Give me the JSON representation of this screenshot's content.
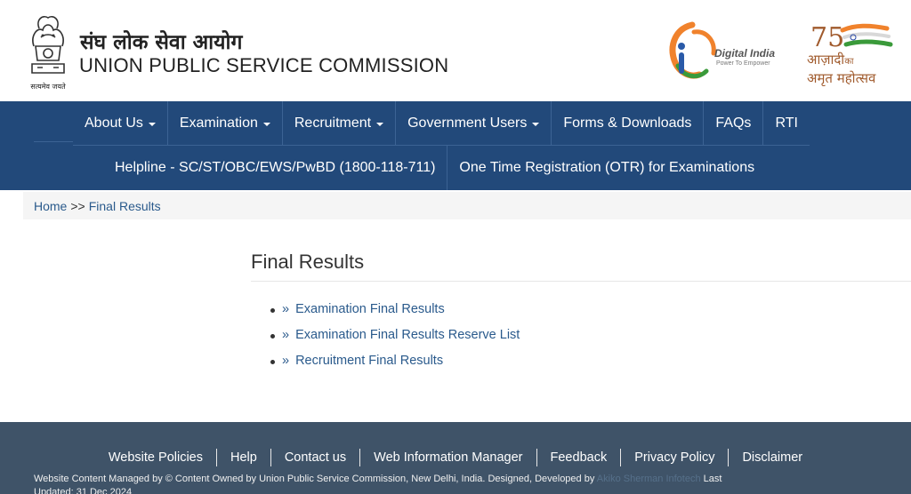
{
  "header": {
    "emblem_motto": "सत्यमेव जयते",
    "title_hindi": "संघ लोक सेवा आयोग",
    "title_english": "UNION PUBLIC SERVICE COMMISSION",
    "digital_india": {
      "name": "Digital India",
      "tagline": "Power To Empower"
    },
    "azadi": {
      "number": "75",
      "line1": "आज़ादी",
      "line1_small": "का",
      "line2": "अमृत महोत्सव"
    }
  },
  "nav": {
    "row1": [
      {
        "label": "About Us",
        "dropdown": true
      },
      {
        "label": "Examination",
        "dropdown": true
      },
      {
        "label": "Recruitment",
        "dropdown": true
      },
      {
        "label": "Government Users",
        "dropdown": true
      },
      {
        "label": "Forms & Downloads",
        "dropdown": false
      },
      {
        "label": "FAQs",
        "dropdown": false
      },
      {
        "label": "RTI",
        "dropdown": false
      }
    ],
    "row2": [
      {
        "label": "Helpline - SC/ST/OBC/EWS/PwBD (1800-118-711)"
      },
      {
        "label": "One Time Registration (OTR) for Examinations"
      }
    ]
  },
  "breadcrumb": {
    "home": "Home",
    "separator": ">>",
    "current": "Final Results"
  },
  "content": {
    "title": "Final Results",
    "links": [
      {
        "marker": "»",
        "label": "Examination Final Results"
      },
      {
        "marker": "»",
        "label": "Examination Final Results Reserve List"
      },
      {
        "marker": "»",
        "label": "Recruitment Final Results"
      }
    ]
  },
  "footer": {
    "links": [
      "Website Policies",
      "Help",
      "Contact us",
      "Web Information Manager",
      "Feedback",
      "Privacy Policy",
      "Disclaimer"
    ],
    "text_prefix": "Website Content Managed by © Content Owned by Union Public Service Commission, New Delhi, India. Designed, Developed by",
    "developer": "Akiko Sherman Infotech",
    "text_suffix": "Last Updated: 31 Dec 2024"
  },
  "colors": {
    "nav_bg": "#22497a",
    "footer_bg": "#3f5368",
    "link": "#2a5a8c",
    "saffron": "#f0822c",
    "green": "#3a9a3a"
  }
}
